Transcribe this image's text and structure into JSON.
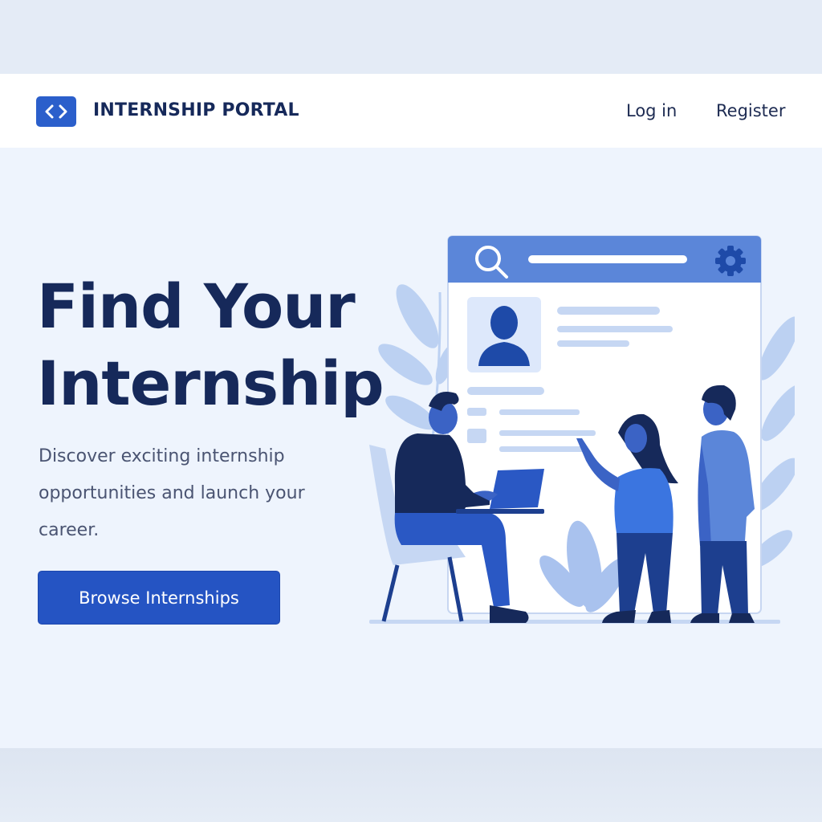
{
  "header": {
    "brand": "INTERNSHIP PORTAL",
    "logo_icon": "code-brackets-icon",
    "nav": {
      "login": "Log in",
      "register": "Register"
    }
  },
  "hero": {
    "title_line1": "Find Your",
    "title_line2": "Internship",
    "description": "Discover exciting internship opportunities and launch your career.",
    "cta_label": "Browse Internships"
  },
  "illustration": {
    "icons": [
      "search-icon",
      "gear-icon",
      "user-avatar-icon"
    ]
  },
  "colors": {
    "brand": "#2b5fcb",
    "primary_button": "#2554c3",
    "heading": "#16295a",
    "background": "#eef4fd"
  }
}
